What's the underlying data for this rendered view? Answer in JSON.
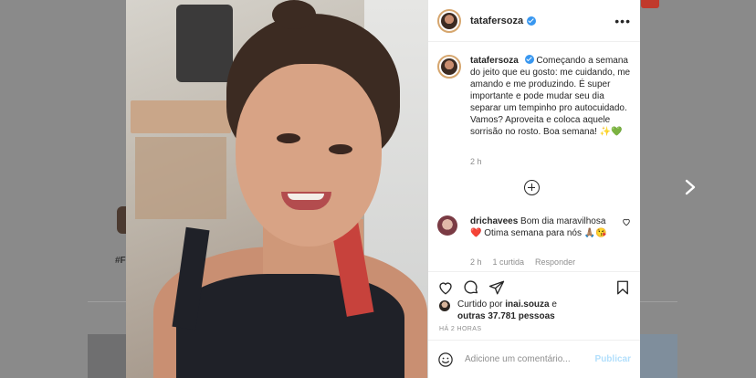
{
  "background": {
    "partial_text": "#F"
  },
  "post": {
    "username": "tatafersoza",
    "more_label": "•••",
    "caption": "Começando a semana do jeito que eu gosto: me cuidando, me amando e me produzindo. É super importante e pode mudar seu dia separar um tempinho pro autocuidado. Vamos? Aproveita e coloca aquele sorrisão no rosto. Boa semana! ✨💚",
    "caption_time": "2 h",
    "comment": {
      "username": "drichavees",
      "text": "Bom dia maravilhosa ❤️ Otima semana para nós 🙏🏽😘",
      "time": "2 h",
      "likes": "1 curtida",
      "reply": "Responder"
    },
    "liked_by": {
      "prefix": "Curtido por",
      "user": "inai.souza",
      "and": "e",
      "others": "outras 37.781 pessoas"
    },
    "age": "HÁ 2 HORAS",
    "comment_placeholder": "Adicione um comentário...",
    "publish_label": "Publicar"
  },
  "colors": {
    "verified": "#3897f0",
    "publish_disabled": "#b2dffc",
    "overlay": "#8a8a8a"
  },
  "icons": [
    "chevron-right-icon",
    "more-icon",
    "verified-icon",
    "add-circle-icon",
    "heart-icon",
    "comment-icon",
    "share-icon",
    "bookmark-icon",
    "emoji-icon"
  ]
}
